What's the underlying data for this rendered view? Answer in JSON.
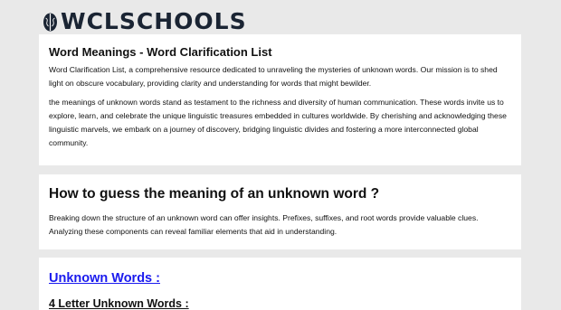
{
  "logo": {
    "text": "WCLSCHOOLS",
    "icon": "brain-icon"
  },
  "intro": {
    "title": "Word Meanings - Word Clarification List",
    "paragraph1": "Word Clarification List, a comprehensive resource dedicated to unraveling the mysteries of unknown words. Our mission is to shed light on obscure vocabulary, providing clarity and understanding for words that might bewilder.",
    "paragraph2": "the meanings of unknown words stand as testament to the richness and diversity of human communication. These words invite us to explore, learn, and celebrate the unique linguistic treasures embedded in cultures worldwide. By cherishing and acknowledging these linguistic marvels, we embark on a journey of discovery, bridging linguistic divides and fostering a more interconnected global community."
  },
  "guess": {
    "title": "How to guess the meaning of an unknown word ?",
    "paragraph": "Breaking down the structure of an unknown word can offer insights. Prefixes, suffixes, and root words provide valuable clues. Analyzing these components can reveal familiar elements that aid in understanding."
  },
  "unknown": {
    "title": "Unknown Words :",
    "subtitle": "4 Letter Unknown Words :"
  },
  "colors": {
    "background": "#e9e9e9",
    "card": "#ffffff",
    "link": "#1a1aee",
    "logo": "#1a2433"
  }
}
